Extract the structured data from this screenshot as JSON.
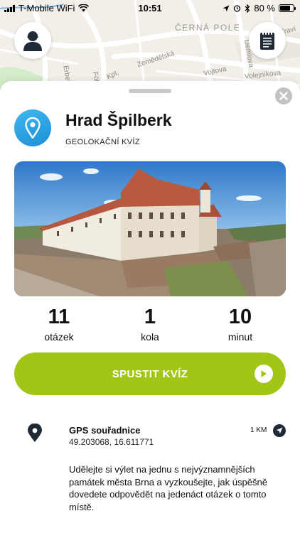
{
  "status_bar": {
    "carrier": "T-Mobile WiFi",
    "time": "10:51",
    "battery_percent": "80 %",
    "battery_level": 0.8,
    "icons": [
      "signal-icon",
      "wifi-icon",
      "location-arrow-icon",
      "alarm-icon",
      "bluetooth-icon",
      "battery-icon"
    ]
  },
  "map": {
    "district": "ČERNÁ POLE",
    "streets": [
      "Zemědělská",
      "Demlova",
      "Vojtova",
      "Erbenova",
      "Traví",
      "Volejníkova",
      "Kpt.",
      "Föh"
    ],
    "colors": {
      "land": "#f2efe9",
      "road": "#ffffff",
      "park": "#d3ecc9"
    }
  },
  "header_buttons": {
    "profile_icon": "user-avatar-icon",
    "notebook_icon": "notebook-icon"
  },
  "quiz": {
    "title": "Hrad Špilberk",
    "type_label": "GEOLOKAČNÍ KVÍZ",
    "badge_icon": "map-pin-icon",
    "photo": "castle-photo",
    "stats": [
      {
        "value": "11",
        "label": "otázek"
      },
      {
        "value": "1",
        "label": "kola"
      },
      {
        "value": "10",
        "label": "minut"
      }
    ],
    "start_button": {
      "label": "SPUSTIT KVÍZ",
      "color": "#a2c617"
    }
  },
  "gps": {
    "title": "GPS souřadnice",
    "coordinates": "49.203068, 16.611771",
    "distance": "1 KM"
  },
  "description": "Udělejte si výlet na jednu s nejvýznamnějších památek města Brna a vyzkoušejte, jak úspěšně dovedete odpovědět na jedenáct otázek o tomto místě.",
  "colors": {
    "accent_green": "#a2c617",
    "badge_blue": "#2aa3e3",
    "icon_dark": "#1f2a36"
  }
}
